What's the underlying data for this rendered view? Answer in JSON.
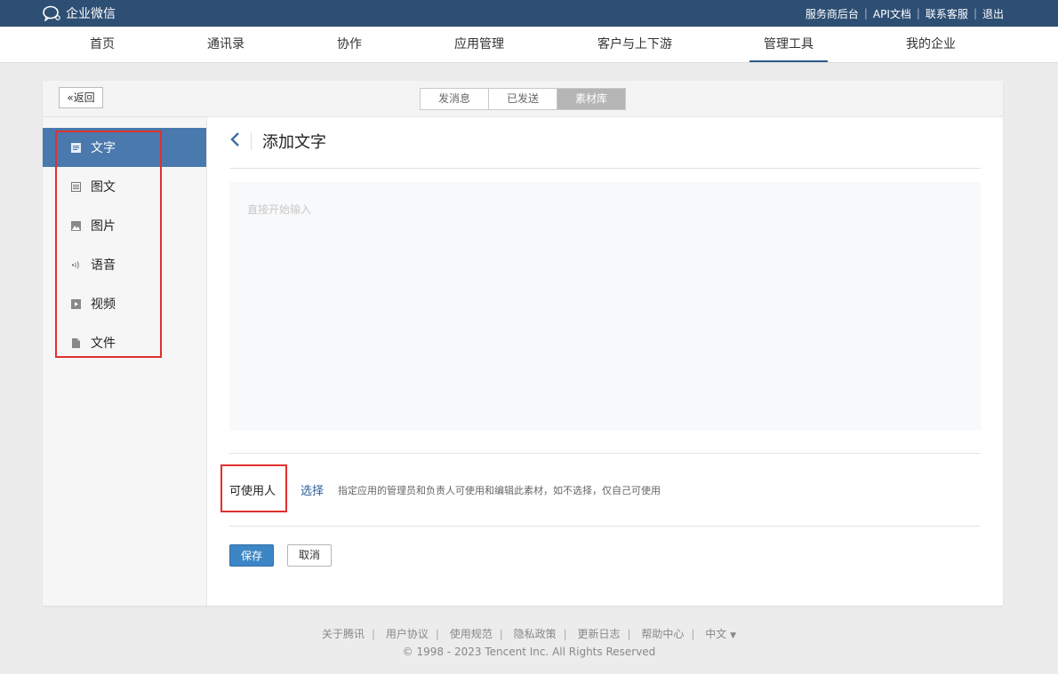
{
  "topbar": {
    "logo_text": "企业微信",
    "links": [
      "服务商后台",
      "API文档",
      "联系客服",
      "退出"
    ]
  },
  "nav": {
    "items": [
      "首页",
      "通讯录",
      "协作",
      "应用管理",
      "客户与上下游",
      "管理工具",
      "我的企业"
    ],
    "active": "管理工具"
  },
  "card": {
    "back_label": "返回",
    "tabs": [
      "发消息",
      "已发送",
      "素材库"
    ],
    "active_tab": "素材库"
  },
  "sidebar": {
    "items": [
      {
        "label": "文字",
        "icon": "text-icon"
      },
      {
        "label": "图文",
        "icon": "article-icon"
      },
      {
        "label": "图片",
        "icon": "image-icon"
      },
      {
        "label": "语音",
        "icon": "voice-icon"
      },
      {
        "label": "视频",
        "icon": "video-icon"
      },
      {
        "label": "文件",
        "icon": "file-icon"
      }
    ],
    "active": "文字"
  },
  "main": {
    "title": "添加文字",
    "placeholder": "直接开始输入",
    "users_label": "可使用人",
    "choose_label": "选择",
    "hint": "指定应用的管理员和负责人可使用和编辑此素材，如不选择，仅自己可使用",
    "save_label": "保存",
    "cancel_label": "取消"
  },
  "footer": {
    "links": [
      "关于腾讯",
      "用户协议",
      "使用规范",
      "隐私政策",
      "更新日志",
      "帮助中心"
    ],
    "language": "中文",
    "copyright": "© 1998 - 2023 Tencent Inc. All Rights Reserved"
  },
  "colors": {
    "topbar": "#2e4f74",
    "accent": "#4a79ad",
    "highlight_box": "#e0302e"
  }
}
